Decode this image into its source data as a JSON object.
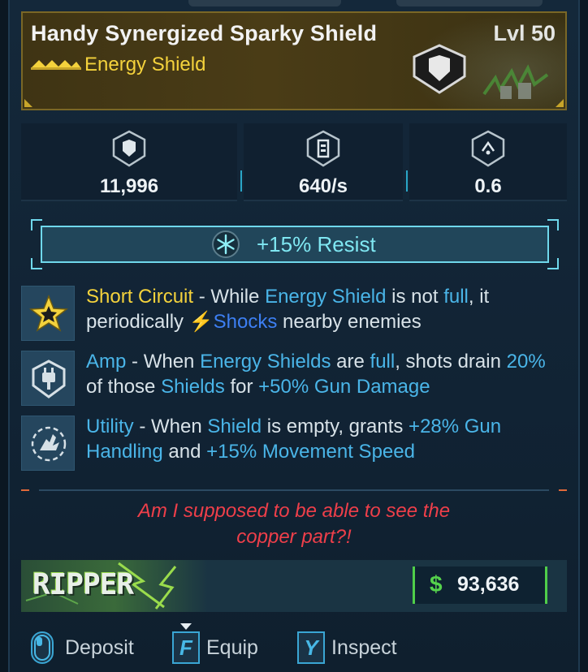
{
  "item": {
    "name": "Handy Synergized Sparky Shield",
    "level": "Lvl 50",
    "type": "Energy Shield",
    "rarity_icon": "rarity-chevrons-icon",
    "manufacturer_icon": "shield-badge-icon"
  },
  "stats": [
    {
      "icon": "shield-capacity-icon",
      "value": "11,996"
    },
    {
      "icon": "recharge-rate-icon",
      "value": "640/s"
    },
    {
      "icon": "recharge-delay-icon",
      "value": "0.6"
    }
  ],
  "resist": {
    "icon": "cryo-snowflake-icon",
    "text": "+15% Resist"
  },
  "perks": [
    {
      "icon": "short-circuit-star-icon",
      "name": "Short Circuit",
      "t1": " - While ",
      "h1": "Energy Shield",
      "t2": " is not ",
      "h2": "full",
      "t3": ", it periodically ",
      "h3": "Shocks",
      "t4": " nearby enemies"
    },
    {
      "icon": "amp-shield-plug-icon",
      "name": "Amp",
      "t1": " - When ",
      "h1": "Energy Shields",
      "t2": " are ",
      "h2": "full",
      "t3": ", shots drain ",
      "h3": "20%",
      "t4": " of those ",
      "h4": "Shields",
      "t5": " for ",
      "h5": "+50% Gun Damage"
    },
    {
      "icon": "utility-hand-icon",
      "name": "Utility",
      "t1": " - When ",
      "h1": "Shield",
      "t2": " is empty, grants ",
      "h2": "+28% Gun Handling",
      "t3": " and ",
      "h3": "+15% Movement Speed"
    }
  ],
  "flavor": {
    "line1": "Am I supposed to be able to see the",
    "line2": "copper part?!"
  },
  "brand": {
    "logo": "RIPPER"
  },
  "price": {
    "currency": "$",
    "value": "93,636"
  },
  "actions": [
    {
      "key": "",
      "key_icon": "mouse-icon",
      "label": "Deposit"
    },
    {
      "key": "F",
      "label": "Equip"
    },
    {
      "key": "Y",
      "label": "Inspect"
    }
  ],
  "colors": {
    "legendary": "#f4d23c",
    "highlight": "#4ab5e8",
    "shock": "#3d7ff2",
    "flavor": "#ee3f4a",
    "price": "#55d24c",
    "cryo": "#7fe7f2"
  }
}
